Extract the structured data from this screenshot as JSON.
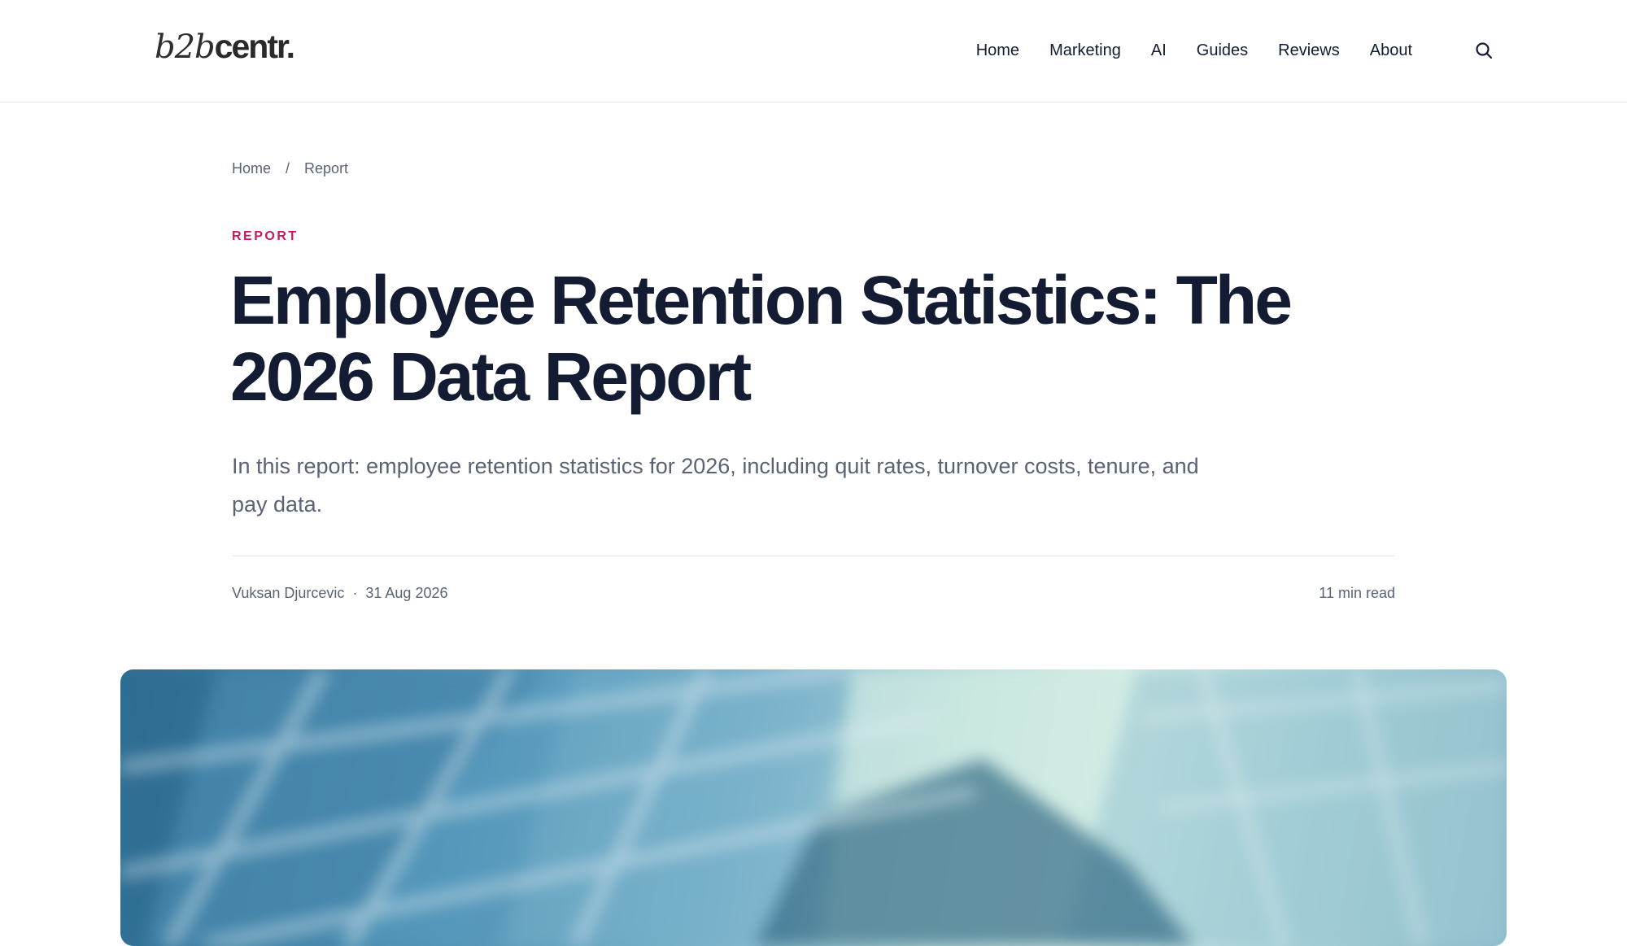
{
  "header": {
    "logo": {
      "part1": "b2b",
      "part2": "centr."
    },
    "nav": [
      {
        "label": "Home"
      },
      {
        "label": "Marketing"
      },
      {
        "label": "AI"
      },
      {
        "label": "Guides"
      },
      {
        "label": "Reviews"
      },
      {
        "label": "About"
      }
    ],
    "search_icon": "search-icon"
  },
  "breadcrumb": {
    "items": [
      {
        "label": "Home"
      },
      {
        "label": "Report"
      }
    ],
    "separator": "/"
  },
  "article": {
    "category": "REPORT",
    "title": "Employee Retention Statistics: The 2026 Data Report",
    "dek": "In this report: employee retention statistics for 2026, including quit rates, turnover costs, tenure, and pay data.",
    "author": "Vuksan Djurcevic",
    "separator": "·",
    "date": "31 Aug 2026",
    "read_time": "11 min read"
  },
  "colors": {
    "accent": "#c51b5c",
    "heading": "#141c33",
    "muted": "#5a6374",
    "border": "#e6e8ec"
  }
}
